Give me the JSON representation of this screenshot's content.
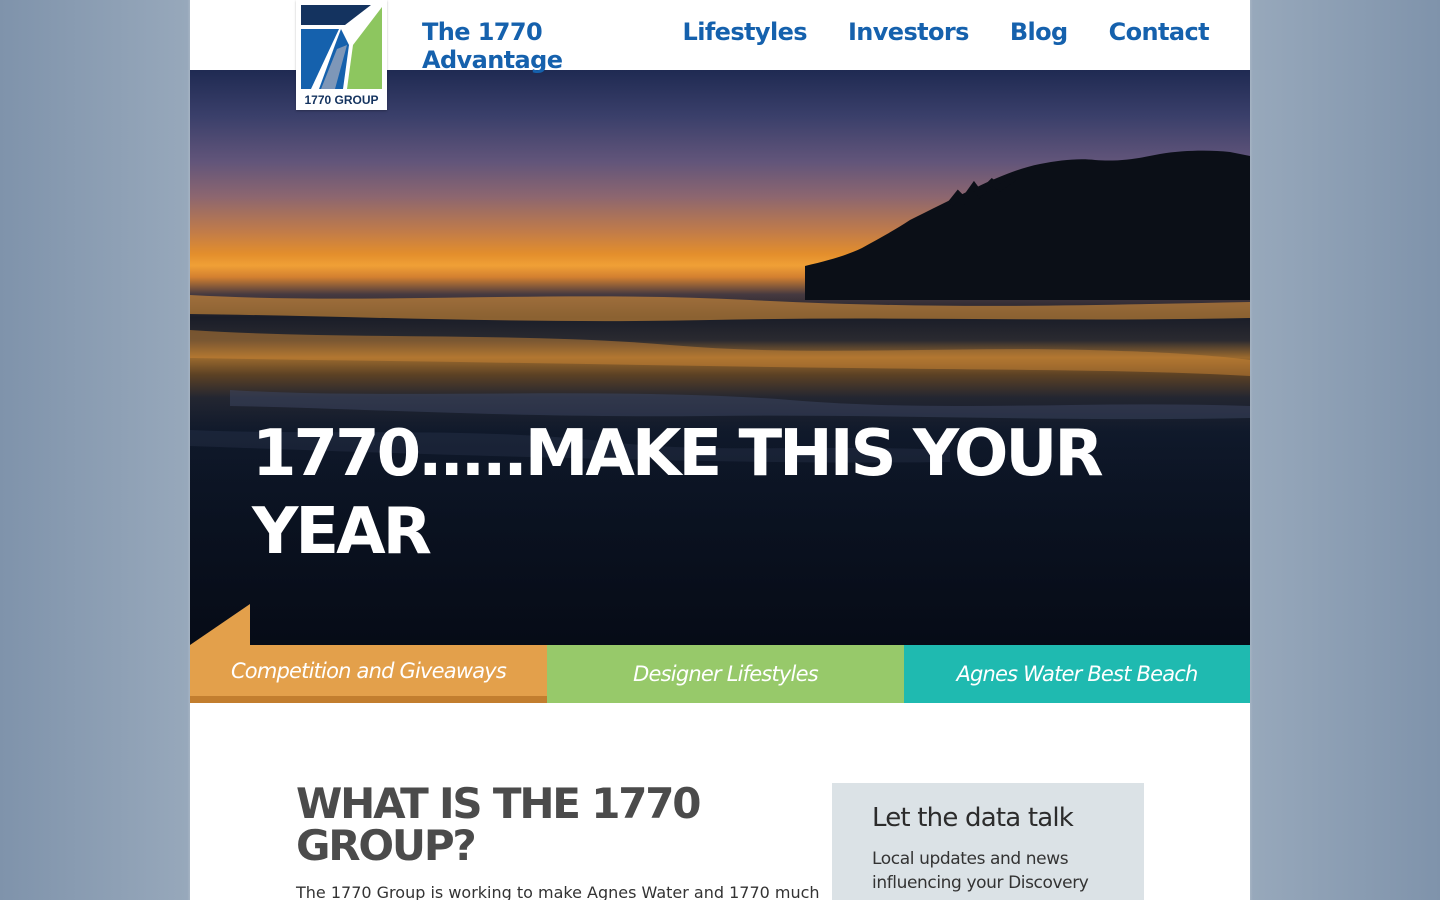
{
  "brand": {
    "logo_text": "1770 GROUP",
    "colors": {
      "navy": "#14335f",
      "blue": "#1561ad",
      "green": "#8dc65f"
    }
  },
  "nav": {
    "items": [
      {
        "label": "The 1770 Advantage"
      },
      {
        "label": "Lifestyles"
      },
      {
        "label": "Investors"
      },
      {
        "label": "Blog"
      },
      {
        "label": "Contact"
      }
    ]
  },
  "hero": {
    "title": "1770.....MAKE THIS YOUR YEAR"
  },
  "features": [
    {
      "label": "Competition and Giveaways",
      "color": "#e3a04b"
    },
    {
      "label": "Designer Lifestyles",
      "color": "#97c96a"
    },
    {
      "label": "Agnes Water Best Beach",
      "color": "#1fbab0"
    }
  ],
  "about": {
    "title": "WHAT IS THE 1770 GROUP?",
    "text": "The 1770 Group is working to make Agnes Water and 1770 much"
  },
  "sidebar": {
    "title": "Let the data talk",
    "text": "Local updates and news influencing your Discovery"
  }
}
